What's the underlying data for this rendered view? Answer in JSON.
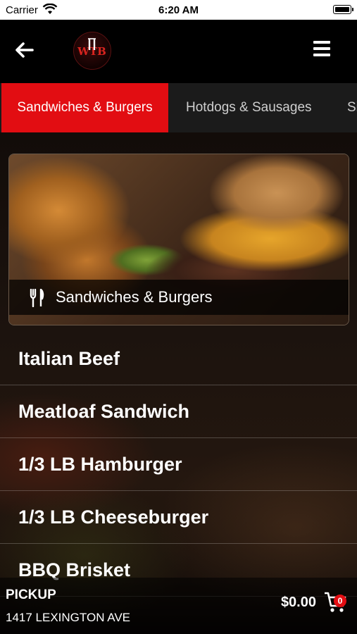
{
  "status_bar": {
    "carrier": "Carrier",
    "time": "6:20 AM"
  },
  "header": {
    "logo_text": "WTB"
  },
  "tabs": [
    {
      "label": "Sandwiches & Burgers",
      "active": true
    },
    {
      "label": "Hotdogs & Sausages",
      "active": false
    },
    {
      "label": "Si",
      "active": false
    }
  ],
  "banner": {
    "caption": "Sandwiches & Burgers"
  },
  "menu_items": [
    {
      "name": "Italian Beef"
    },
    {
      "name": "Meatloaf Sandwich"
    },
    {
      "name": "1/3 LB Hamburger"
    },
    {
      "name": "1/3 LB Cheeseburger"
    },
    {
      "name": "BBQ Brisket"
    }
  ],
  "footer": {
    "pickup_label": "PICKUP",
    "address": "1417 LEXINGTON AVE",
    "total": "$0.00",
    "cart_count": "0"
  },
  "colors": {
    "accent": "#e20d12",
    "background": "#000000",
    "tab_bar": "#1b1b1b"
  },
  "icons": {
    "back": "arrow-left-icon",
    "menu": "hamburger-menu-icon",
    "banner": "fork-knife-icon",
    "cart": "shopping-cart-icon",
    "wifi": "wifi-icon",
    "battery": "battery-icon"
  }
}
